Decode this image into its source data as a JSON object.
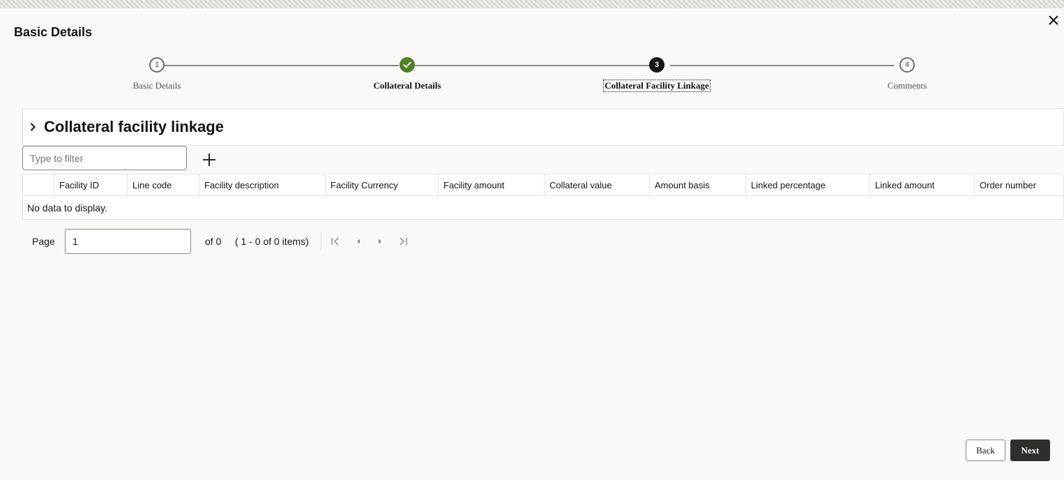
{
  "dialog": {
    "title": "Basic Details"
  },
  "stepper": {
    "steps": [
      {
        "number": "1",
        "label": "Basic Details",
        "state": "pending"
      },
      {
        "number": "",
        "label": "Collateral Details",
        "state": "done"
      },
      {
        "number": "3",
        "label": "Collateral Facility Linkage",
        "state": "current"
      },
      {
        "number": "4",
        "label": "Comments",
        "state": "pending"
      }
    ]
  },
  "section": {
    "title": "Collateral facility linkage",
    "filter_placeholder": "Type to filter"
  },
  "table": {
    "columns": [
      "Facility ID",
      "Line code",
      "Facility description",
      "Facility Currency",
      "Facility amount",
      "Collateral value",
      "Amount basis",
      "Linked percentage",
      "Linked amount",
      "Order number"
    ],
    "empty_message": "No data to display."
  },
  "pagination": {
    "label": "Page",
    "current_page": "1",
    "of_text": "of 0",
    "range_text": "( 1 - 0 of 0 items)"
  },
  "footer": {
    "back_label": "Back",
    "next_label": "Next"
  },
  "colors": {
    "done_green": "#508223",
    "primary_dark": "#312d2a"
  }
}
